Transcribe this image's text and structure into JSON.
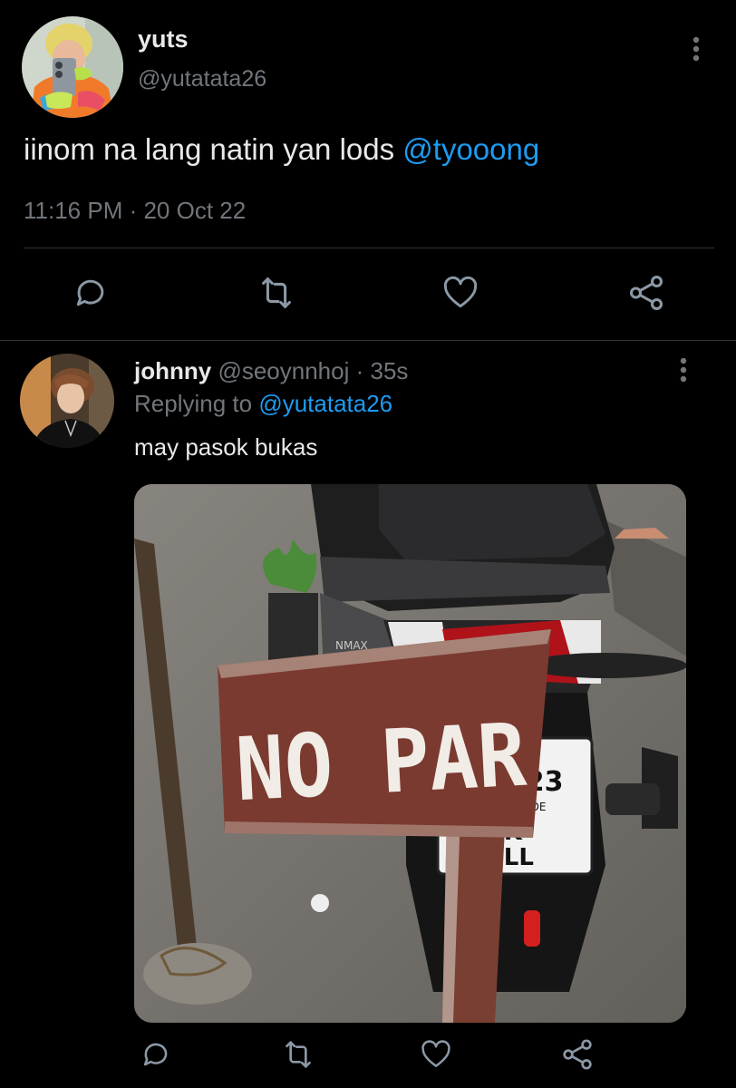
{
  "main_tweet": {
    "author_name": "yuts",
    "author_handle": "@yutatata26",
    "text": "iinom na lang natin yan lods ",
    "mention": "@tyooong",
    "timestamp": "11:16 PM · 20 Oct 22",
    "actions": [
      "reply-icon",
      "retweet-icon",
      "like-icon",
      "share-icon"
    ]
  },
  "reply": {
    "author_name": "johnny",
    "author_handle": "@seoynnhoj",
    "time_ago": " · 35s",
    "replying_prefix": "Replying to ",
    "replying_to": "@yutatata26",
    "text": "may pasok bukas",
    "media": {
      "sign_text": "NO PAR",
      "plate_number": "9223",
      "plate_line2": "TORTRADE",
      "plate_line3": "EK",
      "plate_line4": "ELL",
      "scooter_badge": "NMAX"
    },
    "actions": [
      "reply-icon",
      "retweet-icon",
      "like-icon",
      "share-icon"
    ]
  },
  "colors": {
    "background": "#000000",
    "text": "#e7e9ea",
    "secondary": "#71767b",
    "link": "#1d9bf0",
    "divider": "#2f3336"
  }
}
